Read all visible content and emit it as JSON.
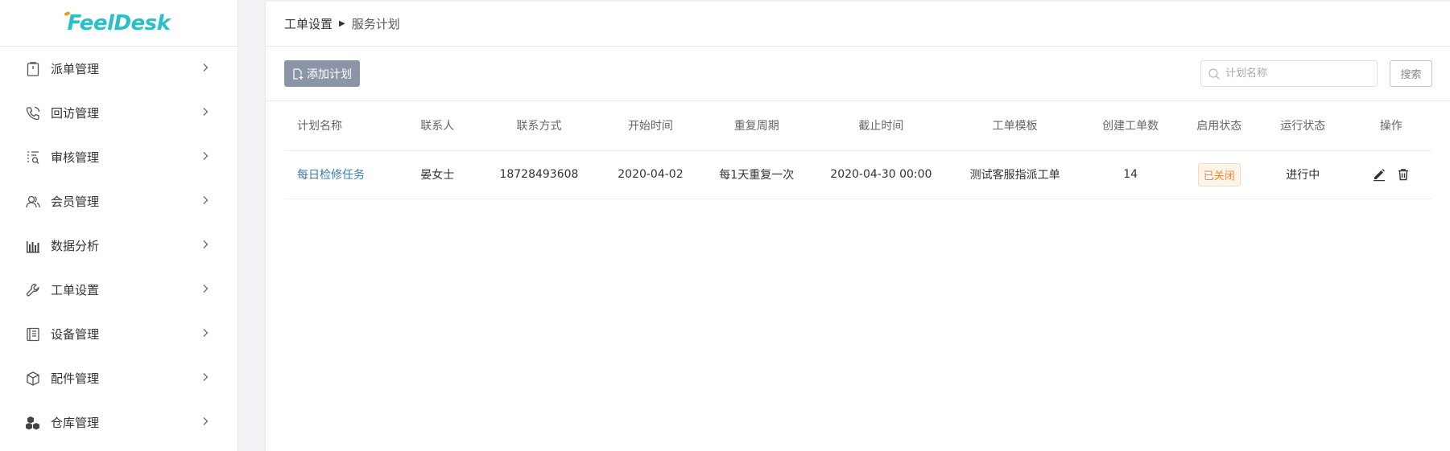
{
  "brand": {
    "logo_text": "FeelDesk"
  },
  "sidebar": {
    "items": [
      {
        "label": "派单管理",
        "icon": "clipboard-icon"
      },
      {
        "label": "回访管理",
        "icon": "phone-icon"
      },
      {
        "label": "审核管理",
        "icon": "audit-icon"
      },
      {
        "label": "会员管理",
        "icon": "users-icon"
      },
      {
        "label": "数据分析",
        "icon": "bar-chart-icon"
      },
      {
        "label": "工单设置",
        "icon": "wrench-icon"
      },
      {
        "label": "设备管理",
        "icon": "device-icon"
      },
      {
        "label": "配件管理",
        "icon": "box-icon"
      },
      {
        "label": "仓库管理",
        "icon": "warehouse-icon"
      }
    ]
  },
  "breadcrumb": {
    "parent": "工单设置",
    "current": "服务计划"
  },
  "toolbar": {
    "add_label": "添加计划",
    "search_placeholder": "计划名称",
    "search_button": "搜索"
  },
  "table": {
    "columns": [
      "计划名称",
      "联系人",
      "联系方式",
      "开始时间",
      "重复周期",
      "截止时间",
      "工单模板",
      "创建工单数",
      "启用状态",
      "运行状态",
      "操作"
    ],
    "rows": [
      {
        "plan_name": "每日检修任务",
        "contact": "晏女士",
        "phone": "18728493608",
        "start_time": "2020-04-02",
        "repeat": "每1天重复一次",
        "end_time": "2020-04-30 00:00",
        "template": "测试客服指派工单",
        "count": "14",
        "enable_status": "已关闭",
        "run_status": "进行中"
      }
    ]
  },
  "colors": {
    "brand": "#2bc0c8",
    "add_button": "#8c95a8",
    "link": "#3a7ca5",
    "status_closed": "#f0883a"
  }
}
